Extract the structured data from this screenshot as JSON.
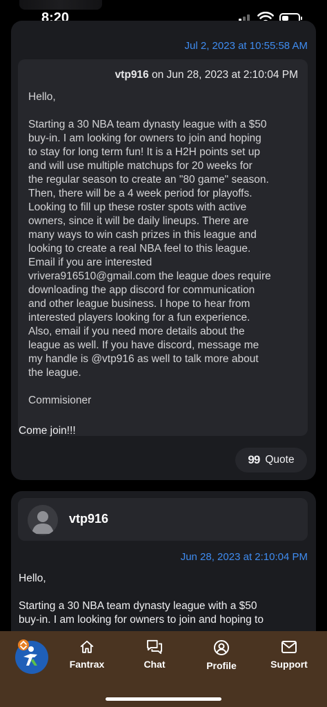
{
  "status_bar": {
    "time": "8:20"
  },
  "post1": {
    "date": "Jul 2, 2023 at 10:55:58 AM",
    "quote": {
      "author": "vtp916",
      "on_text": "on Jun 28, 2023 at 2:10:04 PM",
      "greeting": "Hello,",
      "body": "Starting a 30 NBA team dynasty league with a $50\nbuy-in. I am looking for owners to join and hoping\nto stay for long term fun! It is a H2H points set up\nand will use multiple matchups for 20 weeks for\nthe regular season to create an \"80 game\" season.\nThen, there will be a 4 week period for playoffs.\nLooking to fill up these roster spots with active\nowners, since it will be daily lineups. There are\nmany ways to win cash prizes in this league and\nlooking to create a real NBA feel to this league.\nEmail if you are interested\nvrivera916510@gmail.com the league does require\ndownloading the app discord for communication\nand other league business. I hope to hear from\ninterested players looking for a fun experience.\nAlso, email if you need more details about the\nleague as well. If you have discord, message me\nmy handle is @vtp916 as well to talk more about\nthe league.",
      "signature": "Commisioner"
    },
    "text": "Come join!!!",
    "quote_button": {
      "icon": "quote-icon",
      "label": "Quote"
    }
  },
  "post2": {
    "author": "vtp916",
    "date": "Jun 28, 2023 at 2:10:04 PM",
    "greeting": "Hello,",
    "body": "Starting a 30 NBA team dynasty league with a $50\nbuy-in. I am looking for owners to join and hoping to"
  },
  "nav": {
    "logo": "fantrax-logo",
    "items": [
      {
        "icon": "home-icon",
        "label": "Fantrax"
      },
      {
        "icon": "chat-icon",
        "label": "Chat"
      },
      {
        "icon": "profile-icon",
        "label": "Profile"
      },
      {
        "icon": "mail-icon",
        "label": "Support"
      }
    ]
  },
  "colors": {
    "background": "#000000",
    "card": "#1b1c20",
    "quote_box": "#26272c",
    "date_blue": "#3f8cf0",
    "navbar": "#4a3421"
  }
}
